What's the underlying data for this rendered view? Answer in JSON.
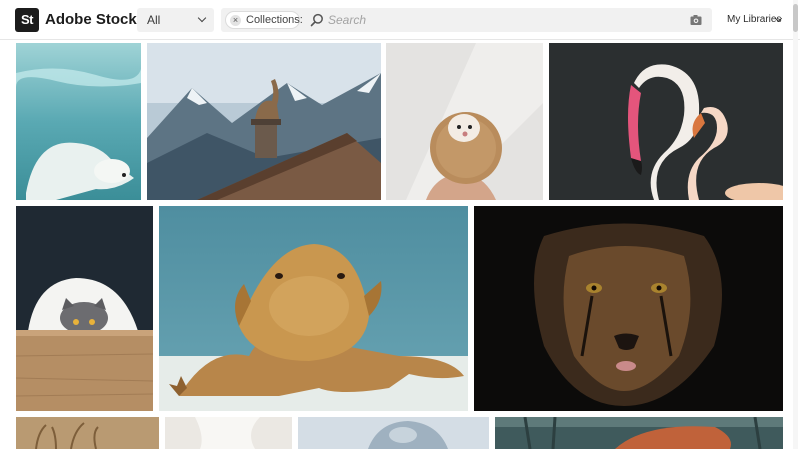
{
  "header": {
    "logo_text": "St",
    "brand": "Adobe Stock",
    "asset_filter": {
      "selected": "All"
    },
    "collections_chip": "Collections:",
    "search": {
      "placeholder": "Search",
      "value": ""
    },
    "my_libraries": "My Libraries"
  },
  "icons": {
    "search": "search-icon",
    "visual_search": "camera-icon",
    "chip_remove": "close-icon",
    "dropdown": "chevron-down-icon"
  },
  "results": [
    {
      "subject": "polar-bear-swimming"
    },
    {
      "subject": "ibex-on-chimney-mountains"
    },
    {
      "subject": "hedgehog-in-hand"
    },
    {
      "subject": "flamingos"
    },
    {
      "subject": "cat-peeking-over-table"
    },
    {
      "subject": "bearded-dragon"
    },
    {
      "subject": "cheetah-face"
    },
    {
      "subject": "dry-plants"
    },
    {
      "subject": "white-fabric"
    },
    {
      "subject": "blue-toy-animal"
    },
    {
      "subject": "orange-bird"
    }
  ]
}
